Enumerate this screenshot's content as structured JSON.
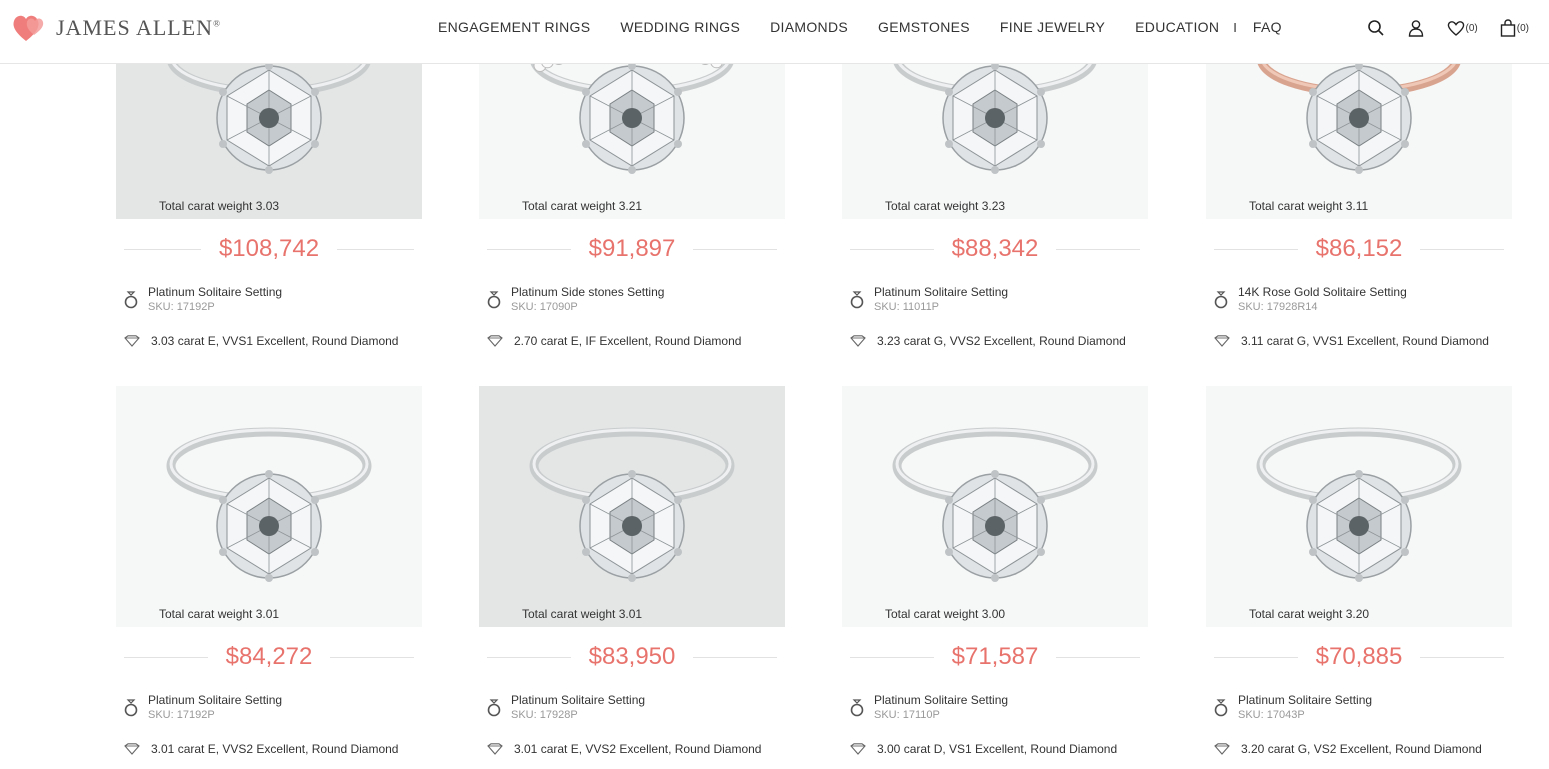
{
  "header": {
    "logo_text": "James Allen",
    "logo_reg": "®",
    "nav": [
      "ENGAGEMENT RINGS",
      "WEDDING RINGS",
      "DIAMONDS",
      "GEMSTONES",
      "FINE JEWELRY",
      "EDUCATION"
    ],
    "nav_separator": "I",
    "nav_faq": "FAQ",
    "wishlist_count": "(0)",
    "cart_count": "(0)"
  },
  "colors": {
    "price": "#e8736d",
    "logo_heart": "#ef7d7b"
  },
  "products": [
    {
      "carat_label": "Total carat weight 3.03",
      "price": "$108,742",
      "setting": "Platinum Solitaire Setting",
      "sku": "SKU: 17192P",
      "diamond": "3.03 carat E, VVS1 Excellent, Round Diamond",
      "band": "platinum"
    },
    {
      "carat_label": "Total carat weight 3.21",
      "price": "$91,897",
      "setting": "Platinum Side stones Setting",
      "sku": "SKU: 17090P",
      "diamond": "2.70 carat E, IF Excellent, Round Diamond",
      "band": "pave"
    },
    {
      "carat_label": "Total carat weight 3.23",
      "price": "$88,342",
      "setting": "Platinum Solitaire Setting",
      "sku": "SKU: 11011P",
      "diamond": "3.23 carat G, VVS2 Excellent, Round Diamond",
      "band": "platinum"
    },
    {
      "carat_label": "Total carat weight 3.11",
      "price": "$86,152",
      "setting": "14K Rose Gold Solitaire Setting",
      "sku": "SKU: 17928R14",
      "diamond": "3.11 carat G, VVS1 Excellent, Round Diamond",
      "band": "rose"
    },
    {
      "carat_label": "Total carat weight 3.01",
      "price": "$84,272",
      "setting": "Platinum Solitaire Setting",
      "sku": "SKU: 17192P",
      "diamond": "3.01 carat E, VVS2 Excellent, Round Diamond",
      "band": "platinum"
    },
    {
      "carat_label": "Total carat weight 3.01",
      "price": "$83,950",
      "setting": "Platinum Solitaire Setting",
      "sku": "SKU: 17928P",
      "diamond": "3.01 carat E, VVS2 Excellent, Round Diamond",
      "band": "platinum"
    },
    {
      "carat_label": "Total carat weight 3.00",
      "price": "$71,587",
      "setting": "Platinum Solitaire Setting",
      "sku": "SKU: 17110P",
      "diamond": "3.00 carat D, VS1 Excellent, Round Diamond",
      "band": "platinum"
    },
    {
      "carat_label": "Total carat weight 3.20",
      "price": "$70,885",
      "setting": "Platinum Solitaire Setting",
      "sku": "SKU: 17043P",
      "diamond": "3.20 carat G, VS2 Excellent, Round Diamond",
      "band": "platinum"
    }
  ]
}
